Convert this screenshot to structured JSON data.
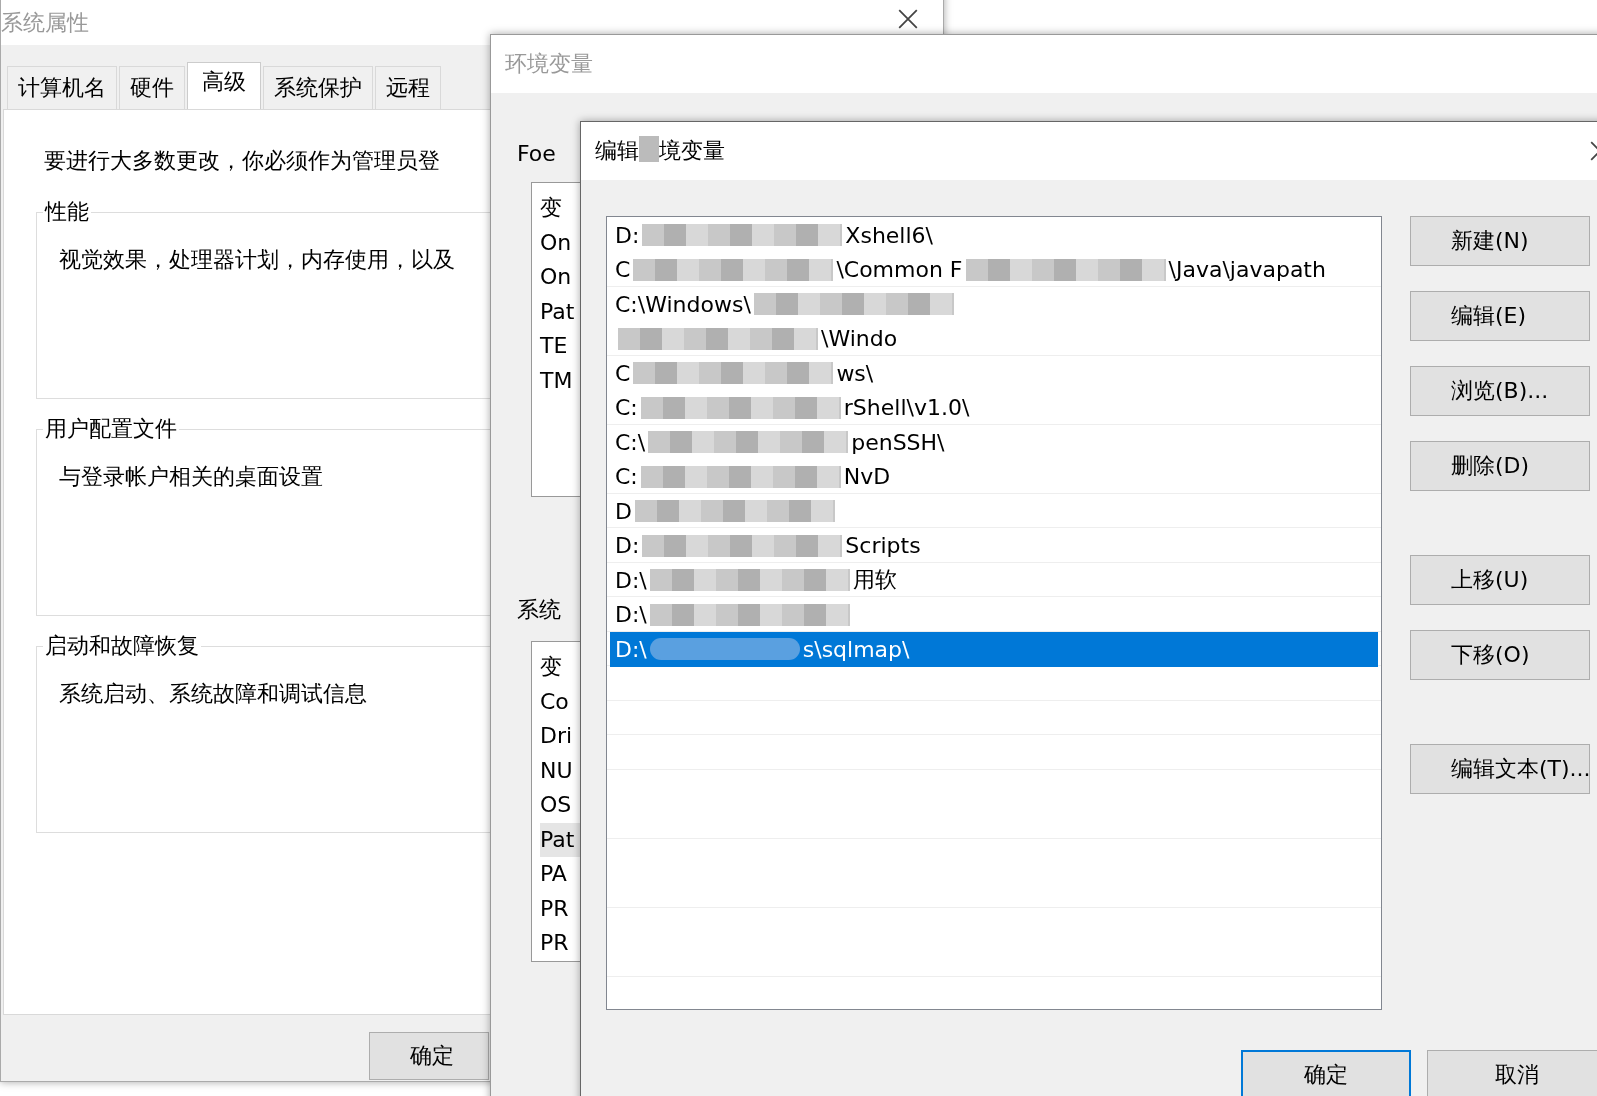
{
  "system_properties": {
    "title": "系统属性",
    "tabs": [
      {
        "label": "计算机名",
        "selected": false
      },
      {
        "label": "硬件",
        "selected": false
      },
      {
        "label": "高级",
        "selected": true
      },
      {
        "label": "系统保护",
        "selected": false
      },
      {
        "label": "远程",
        "selected": false
      }
    ],
    "notice": "要进行大多数更改，你必须作为管理员登",
    "groups": [
      {
        "title": "性能",
        "description": "视觉效果，处理器计划，内存使用，以及"
      },
      {
        "title": "用户配置文件",
        "description": "与登录帐户相关的桌面设置"
      },
      {
        "title": "启动和故障恢复",
        "description": "系统启动、系统故障和调试信息"
      }
    ],
    "ok_button": "确定"
  },
  "environment_variables": {
    "title": "环境变量",
    "user_section": "Foe",
    "user_variables": [
      {
        "name": "变",
        "selected": false
      },
      {
        "name": "On",
        "selected": false
      },
      {
        "name": "On",
        "selected": false
      },
      {
        "name": "Pat",
        "selected": false
      },
      {
        "name": "TE",
        "selected": false
      },
      {
        "name": "TM",
        "selected": false
      }
    ],
    "system_section": "系统",
    "system_variables": [
      {
        "name": "变",
        "selected": false
      },
      {
        "name": "Co",
        "selected": false
      },
      {
        "name": "Dri",
        "selected": false
      },
      {
        "name": "NU",
        "selected": false
      },
      {
        "name": "OS",
        "selected": false
      },
      {
        "name": "Pat",
        "selected": true
      },
      {
        "name": "PA",
        "selected": false
      },
      {
        "name": "PR",
        "selected": false
      },
      {
        "name": "PR",
        "selected": false
      }
    ]
  },
  "edit_dialog": {
    "title_parts": [
      "编辑",
      "境变量"
    ],
    "paths": [
      {
        "parts": [
          "D:",
          "Xshell6\\"
        ],
        "selected": false
      },
      {
        "parts": [
          "C",
          "\\Common F",
          "\\Java\\javapath"
        ],
        "selected": false
      },
      {
        "parts": [
          "C:\\Windows\\"
        ],
        "selected": false
      },
      {
        "parts": [
          "\\Windo"
        ],
        "starts_redacted": true,
        "selected": false
      },
      {
        "parts": [
          "C",
          "ws\\"
        ],
        "selected": false
      },
      {
        "parts": [
          "C:",
          "rShell\\v1.0\\"
        ],
        "selected": false
      },
      {
        "parts": [
          "C:\\",
          "penSSH\\"
        ],
        "selected": false
      },
      {
        "parts": [
          "C:",
          "NvD"
        ],
        "selected": false
      },
      {
        "parts": [
          "D"
        ],
        "selected": false
      },
      {
        "parts": [
          "D:",
          "Scripts"
        ],
        "selected": false
      },
      {
        "parts": [
          "D:\\",
          "用软"
        ],
        "selected": false
      },
      {
        "parts": [
          "D:\\"
        ],
        "selected": false
      },
      {
        "parts": [
          "D:\\",
          "s\\sqlmap\\"
        ],
        "selected": true
      }
    ],
    "button_groups": [
      [
        "新建(N)",
        "编辑(E)",
        "浏览(B)...",
        "删除(D)"
      ],
      [
        "上移(U)",
        "下移(O)"
      ],
      [
        "编辑文本(T)..."
      ]
    ],
    "ok_button": "确定",
    "cancel_button": "取消"
  }
}
